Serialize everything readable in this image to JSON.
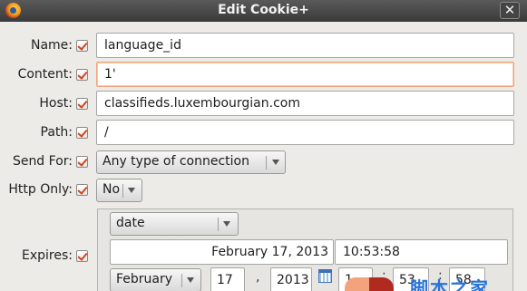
{
  "window": {
    "title": "Edit Cookie+",
    "close_glyph": "✕",
    "app_icon": "firefox-icon"
  },
  "fields": {
    "name": {
      "label": "Name:",
      "value": "language_id"
    },
    "content": {
      "label": "Content:",
      "value": "1'"
    },
    "host": {
      "label": "Host:",
      "value": "classifieds.luxembourgian.com"
    },
    "path": {
      "label": "Path:",
      "value": "/"
    },
    "send_for": {
      "label": "Send For:",
      "value": "Any type of connection"
    },
    "http_only": {
      "label": "Http Only:",
      "value": "No"
    },
    "expires": {
      "label": "Expires:",
      "mode": "date",
      "date_text": "February 17, 2013",
      "time_text": "10:53:58",
      "month": "February",
      "day": "17",
      "year": "2013",
      "hour": "1",
      "minute": "53",
      "second": "58",
      "date_sep": ",",
      "time_sep": ":"
    }
  },
  "watermark": {
    "text": "脚本之家"
  },
  "colors": {
    "accent": "#d1441a",
    "focus_border": "#f0a57a",
    "titlebar": "#4a4a4a"
  }
}
